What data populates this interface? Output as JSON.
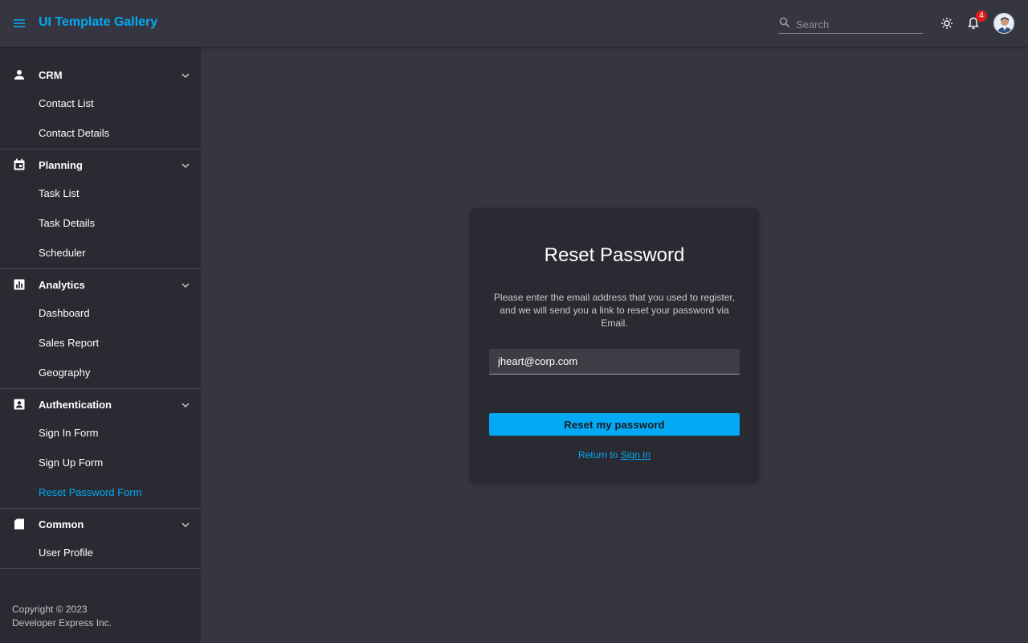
{
  "header": {
    "title": "UI Template Gallery",
    "search_placeholder": "Search",
    "notification_count": "4"
  },
  "sidebar": {
    "groups": [
      {
        "label": "CRM",
        "icon": "person-icon",
        "items": [
          "Contact List",
          "Contact Details"
        ]
      },
      {
        "label": "Planning",
        "icon": "calendar-icon",
        "items": [
          "Task List",
          "Task Details",
          "Scheduler"
        ]
      },
      {
        "label": "Analytics",
        "icon": "chart-icon",
        "items": [
          "Dashboard",
          "Sales Report",
          "Geography"
        ]
      },
      {
        "label": "Authentication",
        "icon": "contact-card-icon",
        "items": [
          "Sign In Form",
          "Sign Up Form",
          "Reset Password Form"
        ],
        "active_item": "Reset Password Form"
      },
      {
        "label": "Common",
        "icon": "folder-icon",
        "items": [
          "User Profile"
        ]
      }
    ],
    "copyright_line1": "Copyright © 2023",
    "copyright_line2": "Developer Express Inc."
  },
  "card": {
    "title": "Reset Password",
    "description": "Please enter the email address that you used to register, and we will send you a link to reset your password via Email.",
    "email_value": "jheart@corp.com",
    "submit_label": "Reset my password",
    "return_prefix": "Return to ",
    "return_link": "Sign In"
  },
  "colors": {
    "accent": "#03a9f4",
    "background": "#363640",
    "sidebar": "#2a2a33",
    "badge": "#e01b1b"
  }
}
